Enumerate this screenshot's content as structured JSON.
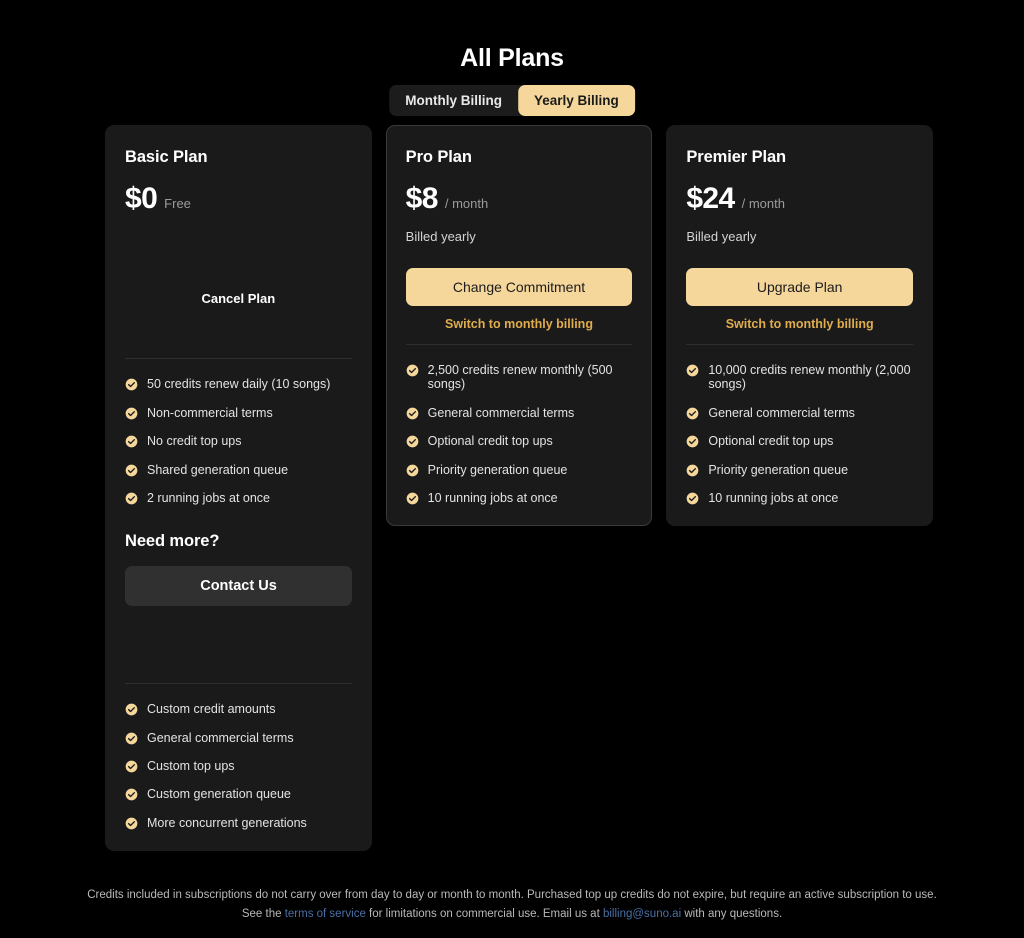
{
  "header": {
    "title": "All Plans",
    "billing_toggle": {
      "options": [
        {
          "label": "Monthly Billing",
          "active": false
        },
        {
          "label": "Yearly Billing",
          "active": true
        }
      ]
    }
  },
  "plans": [
    {
      "name": "Basic Plan",
      "price": "$0",
      "period": "Free",
      "billed_note": "",
      "featured": false,
      "primary_action": "",
      "secondary_action": "",
      "cancel_action": "Cancel Plan",
      "features": [
        "50 credits renew daily (10 songs)",
        "Non-commercial terms",
        "No credit top ups",
        "Shared generation queue",
        "2 running jobs at once"
      ]
    },
    {
      "name": "Pro Plan",
      "price": "$8",
      "period": "/ month",
      "billed_note": "Billed yearly",
      "featured": true,
      "primary_action": "Change Commitment",
      "secondary_action": "Switch to monthly billing",
      "cancel_action": "",
      "features": [
        "2,500 credits renew monthly (500 songs)",
        "General commercial terms",
        "Optional credit top ups",
        "Priority generation queue",
        "10 running jobs at once"
      ]
    },
    {
      "name": "Premier Plan",
      "price": "$24",
      "period": "/ month",
      "billed_note": "Billed yearly",
      "featured": false,
      "primary_action": "Upgrade Plan",
      "secondary_action": "Switch to monthly billing",
      "cancel_action": "",
      "features": [
        "10,000 credits renew monthly (2,000 songs)",
        "General commercial terms",
        "Optional credit top ups",
        "Priority generation queue",
        "10 running jobs at once"
      ]
    }
  ],
  "need_more": {
    "title": "Need more?",
    "contact_label": "Contact Us",
    "features": [
      "Custom credit amounts",
      "General commercial terms",
      "Custom top ups",
      "Custom generation queue",
      "More concurrent generations"
    ]
  },
  "footer": {
    "line1": "Credits included in subscriptions do not carry over from day to day or month to month. Purchased top up credits do not expire, but require an active subscription to use.",
    "line2_part1": "See the ",
    "link_terms": "terms of service",
    "line2_part2": " for limitations on commercial use. Email us at ",
    "link_email": "billing@suno.ai",
    "line2_part3": " with any questions."
  },
  "colors": {
    "background": "#000000",
    "card": "#1a1a1a",
    "accent": "#f6d79b",
    "accent_text": "#e0ad4e",
    "link": "#4a6fa5"
  },
  "icons": {
    "check": "check-circle-icon"
  }
}
